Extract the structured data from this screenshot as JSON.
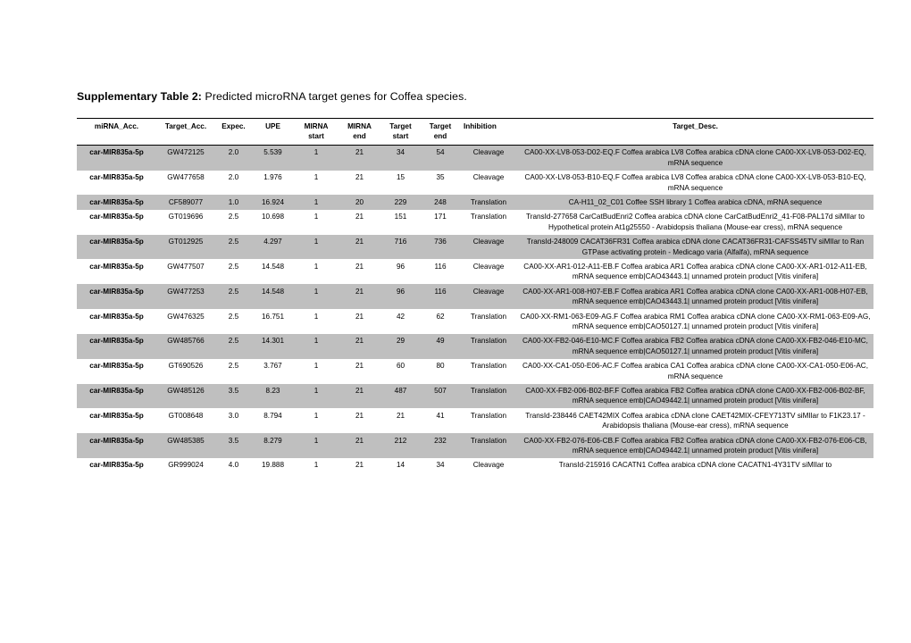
{
  "document": {
    "caption_prefix": "Supplementary Table 2:",
    "caption_rest": " Predicted microRNA target genes for Coffea species."
  },
  "table": {
    "headers": {
      "mirna_acc": "miRNA_Acc.",
      "target_acc": "Target_Acc.",
      "expec": "Expec.",
      "upe": "UPE",
      "mirna_start_l1": "MIRNA",
      "mirna_start_l2": "start",
      "mirna_end_l1": "MIRNA",
      "mirna_end_l2": "end",
      "target_start_l1": "Target",
      "target_start_l2": "start",
      "target_end_l1": "Target",
      "target_end_l2": "end",
      "inhibition": "Inhibition",
      "target_desc": "Target_Desc."
    },
    "rows": [
      {
        "mirna_acc": "car-MIR835a-5p",
        "target_acc": "GW472125",
        "expec": "2.0",
        "upe": "5.539",
        "mirna_start": "1",
        "mirna_end": "21",
        "target_start": "34",
        "target_end": "54",
        "inhibition": "Cleavage",
        "target_desc": "CA00-XX-LV8-053-D02-EQ.F Coffea arabica LV8 Coffea arabica cDNA clone CA00-XX-LV8-053-D02-EQ, mRNA sequence",
        "shaded": true
      },
      {
        "mirna_acc": "car-MIR835a-5p",
        "target_acc": "GW477658",
        "expec": "2.0",
        "upe": "1.976",
        "mirna_start": "1",
        "mirna_end": "21",
        "target_start": "15",
        "target_end": "35",
        "inhibition": "Cleavage",
        "target_desc": "CA00-XX-LV8-053-B10-EQ.F Coffea arabica LV8 Coffea arabica cDNA clone CA00-XX-LV8-053-B10-EQ, mRNA sequence",
        "shaded": false
      },
      {
        "mirna_acc": "car-MIR835a-5p",
        "target_acc": "CF589077",
        "expec": "1.0",
        "upe": "16.924",
        "mirna_start": "1",
        "mirna_end": "20",
        "target_start": "229",
        "target_end": "248",
        "inhibition": "Translation",
        "target_desc": "CA-H11_02_C01 Coffee SSH library 1 Coffea arabica cDNA, mRNA sequence",
        "shaded": true
      },
      {
        "mirna_acc": "car-MIR835a-5p",
        "target_acc": "GT019696",
        "expec": "2.5",
        "upe": "10.698",
        "mirna_start": "1",
        "mirna_end": "21",
        "target_start": "151",
        "target_end": "171",
        "inhibition": "Translation",
        "target_desc": "TransId-277658 CarCatBudEnri2 Coffea arabica cDNA clone CarCatBudEnri2_41-F08-PAL17d siMIlar to Hypothetical protein At1g25550 - Arabidopsis thaliana (Mouse-ear cress), mRNA sequence",
        "shaded": false
      },
      {
        "mirna_acc": "car-MIR835a-5p",
        "target_acc": "GT012925",
        "expec": "2.5",
        "upe": "4.297",
        "mirna_start": "1",
        "mirna_end": "21",
        "target_start": "716",
        "target_end": "736",
        "inhibition": "Cleavage",
        "target_desc": "TransId-248009 CACAT36FR31 Coffea arabica cDNA clone CACAT36FR31-CAFSS45TV siMIlar to Ran GTPase activating protein - Medicago varia (Alfalfa), mRNA sequence",
        "shaded": true
      },
      {
        "mirna_acc": "car-MIR835a-5p",
        "target_acc": "GW477507",
        "expec": "2.5",
        "upe": "14.548",
        "mirna_start": "1",
        "mirna_end": "21",
        "target_start": "96",
        "target_end": "116",
        "inhibition": "Cleavage",
        "target_desc": "CA00-XX-AR1-012-A11-EB.F Coffea arabica AR1 Coffea arabica cDNA clone CA00-XX-AR1-012-A11-EB, mRNA sequence emb|CAO43443.1| unnamed protein product [Vitis vinifera]",
        "shaded": false
      },
      {
        "mirna_acc": "car-MIR835a-5p",
        "target_acc": "GW477253",
        "expec": "2.5",
        "upe": "14.548",
        "mirna_start": "1",
        "mirna_end": "21",
        "target_start": "96",
        "target_end": "116",
        "inhibition": "Cleavage",
        "target_desc": "CA00-XX-AR1-008-H07-EB.F Coffea arabica AR1 Coffea arabica cDNA clone CA00-XX-AR1-008-H07-EB, mRNA sequence emb|CAO43443.1| unnamed protein product [Vitis vinifera]",
        "shaded": true
      },
      {
        "mirna_acc": "car-MIR835a-5p",
        "target_acc": "GW476325",
        "expec": "2.5",
        "upe": "16.751",
        "mirna_start": "1",
        "mirna_end": "21",
        "target_start": "42",
        "target_end": "62",
        "inhibition": "Translation",
        "target_desc": "CA00-XX-RM1-063-E09-AG.F Coffea arabica RM1 Coffea arabica cDNA clone CA00-XX-RM1-063-E09-AG, mRNA sequence emb|CAO50127.1| unnamed protein product [Vitis vinifera]",
        "shaded": false
      },
      {
        "mirna_acc": "car-MIR835a-5p",
        "target_acc": "GW485766",
        "expec": "2.5",
        "upe": "14.301",
        "mirna_start": "1",
        "mirna_end": "21",
        "target_start": "29",
        "target_end": "49",
        "inhibition": "Translation",
        "target_desc": "CA00-XX-FB2-046-E10-MC.F Coffea arabica FB2 Coffea arabica cDNA clone CA00-XX-FB2-046-E10-MC, mRNA sequence emb|CAO50127.1| unnamed protein product [Vitis vinifera]",
        "shaded": true
      },
      {
        "mirna_acc": "car-MIR835a-5p",
        "target_acc": "GT690526",
        "expec": "2.5",
        "upe": "3.767",
        "mirna_start": "1",
        "mirna_end": "21",
        "target_start": "60",
        "target_end": "80",
        "inhibition": "Translation",
        "target_desc": "CA00-XX-CA1-050-E06-AC.F Coffea arabica CA1 Coffea arabica cDNA clone CA00-XX-CA1-050-E06-AC, mRNA sequence",
        "shaded": false
      },
      {
        "mirna_acc": "car-MIR835a-5p",
        "target_acc": "GW485126",
        "expec": "3.5",
        "upe": "8.23",
        "mirna_start": "1",
        "mirna_end": "21",
        "target_start": "487",
        "target_end": "507",
        "inhibition": "Translation",
        "target_desc": "CA00-XX-FB2-006-B02-BF.F Coffea arabica FB2 Coffea arabica cDNA clone CA00-XX-FB2-006-B02-BF, mRNA sequence emb|CAO49442.1| unnamed protein product [Vitis vinifera]",
        "shaded": true
      },
      {
        "mirna_acc": "car-MIR835a-5p",
        "target_acc": "GT008648",
        "expec": "3.0",
        "upe": "8.794",
        "mirna_start": "1",
        "mirna_end": "21",
        "target_start": "21",
        "target_end": "41",
        "inhibition": "Translation",
        "target_desc": "TransId-238446 CAET42MIX Coffea arabica cDNA clone CAET42MIX-CFEY713TV siMIlar to F1K23.17 - Arabidopsis thaliana (Mouse-ear cress), mRNA sequence",
        "shaded": false
      },
      {
        "mirna_acc": "car-MIR835a-5p",
        "target_acc": "GW485385",
        "expec": "3.5",
        "upe": "8.279",
        "mirna_start": "1",
        "mirna_end": "21",
        "target_start": "212",
        "target_end": "232",
        "inhibition": "Translation",
        "target_desc": "CA00-XX-FB2-076-E06-CB.F Coffea arabica FB2 Coffea arabica cDNA clone CA00-XX-FB2-076-E06-CB, mRNA sequence emb|CAO49442.1| unnamed protein product [Vitis vinifera]",
        "shaded": true
      },
      {
        "mirna_acc": "car-MIR835a-5p",
        "target_acc": "GR999024",
        "expec": "4.0",
        "upe": "19.888",
        "mirna_start": "1",
        "mirna_end": "21",
        "target_start": "14",
        "target_end": "34",
        "inhibition": "Cleavage",
        "target_desc": "TransId-215916 CACATN1 Coffea arabica cDNA clone CACATN1-4Y31TV siMIlar to",
        "shaded": false
      }
    ]
  },
  "colors": {
    "shaded_row": "#bfbfbf",
    "text": "#000000",
    "page_background": "#ffffff",
    "rule": "#000000"
  }
}
